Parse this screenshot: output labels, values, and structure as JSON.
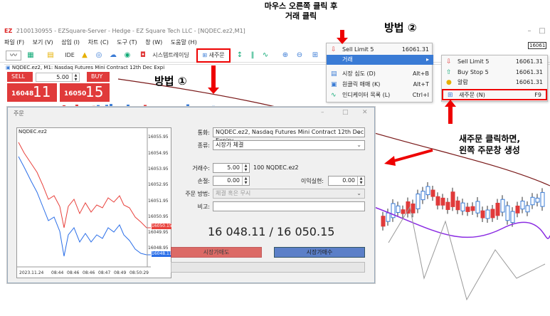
{
  "window": {
    "title": "2100130955 - EZSquare-Server - Hedge - EZ Square Tech LLC - [NQDEC.ez2,M1]",
    "logo": "EZ"
  },
  "menu": [
    "파일 (F)",
    "보기 (V)",
    "삽입 (I)",
    "차트 (C)",
    "도구 (T)",
    "창 (W)",
    "도움말 (H)"
  ],
  "toolbar": {
    "ide_label": "IDE",
    "system_trading": "시스템트레이딩",
    "new_order": "새주문"
  },
  "annotations": {
    "right_click": "마우스 오른쪽 클릭 후\n거래 클릭",
    "method2": "방법 ②",
    "method1": "방법 ①",
    "new_order_note": "새주문 클릭하면,\n왼쪽 주문창 생성"
  },
  "chart": {
    "header": "NQDEC.ez2, M1:  Nasdaq Futures Mini Contract 12th Dec Expi",
    "sell_label": "SELL",
    "buy_label": "BUY",
    "lot": "5.00",
    "sell_price_small": "16048",
    "sell_price_big": "11",
    "buy_price_small": "16050",
    "buy_price_big": "15",
    "right_price": "16061"
  },
  "context_menu": {
    "items": [
      {
        "label": "Sell Limit 5",
        "key": "16061.31",
        "icon": "sell-limit-icon"
      },
      {
        "label": "거래",
        "key": "",
        "icon": ""
      },
      {
        "label": "시장 심도 (D)",
        "key": "Alt+B",
        "icon": "market-depth-icon"
      },
      {
        "label": "원클릭 매매 (K)",
        "key": "Alt+T",
        "icon": "one-click-icon"
      },
      {
        "label": "인디케이터 목록 (L)",
        "key": "Ctrl+I",
        "icon": "indicator-icon"
      }
    ]
  },
  "submenu": {
    "items": [
      {
        "label": "Sell Limit 5",
        "key": "16061.31",
        "icon": "sell-limit-icon"
      },
      {
        "label": "Buy Stop 5",
        "key": "16061.31",
        "icon": "buy-stop-icon"
      },
      {
        "label": "알람",
        "key": "16061.31",
        "icon": "alarm-icon"
      },
      {
        "label": "새주문 (N)",
        "key": "F9",
        "icon": "new-order-icon"
      }
    ]
  },
  "dialog": {
    "title": "주문",
    "mini_chart": {
      "symbol": "NQDEC.ez2",
      "y_ticks": [
        "16055.95",
        "16054.95",
        "16053.95",
        "16052.95",
        "16051.95",
        "16050.95",
        "16049.95",
        "16048.95"
      ],
      "x_ticks": [
        "2023.11.24",
        "08:44",
        "08:46",
        "08:46",
        "08:47",
        "08:49",
        "08:50:29"
      ],
      "ask_tag": "16050.15",
      "bid_tag": "16048.11"
    },
    "fields": {
      "symbol_label": "통화:",
      "symbol_value": "NQDEC.ez2, Nasdaq Futures Mini Contract 12th Dec Expiry",
      "type_label": "종류:",
      "type_value": "시장가 체결",
      "volume_label": "거래수:",
      "volume_value": "5.00",
      "volume_note": "100 NQDEC.ez2",
      "sl_label": "손절:",
      "sl_value": "0.00",
      "tp_label": "이익실현:",
      "tp_value": "0.00",
      "fill_label": "주문 방법:",
      "fill_value": "체결 혹은 무시",
      "comment_label": "비고:",
      "comment_value": ""
    },
    "price": "16 048.11 / 16 050.15",
    "sell_button": "시장가매도",
    "buy_button": "시장가매수"
  },
  "colors": {
    "accent_red": "#e00000",
    "sell_red": "#e03a3a",
    "ask_line": "#e8413c",
    "bid_line": "#2a6ee8",
    "highlight": "#3a7bd5"
  }
}
